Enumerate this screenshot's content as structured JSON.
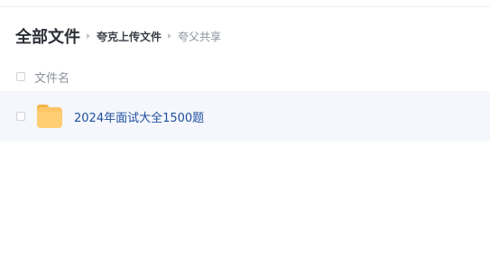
{
  "breadcrumb": {
    "root": "全部文件",
    "middle": "夸克上传文件",
    "current": "夸父共享"
  },
  "list": {
    "column_header": "文件名",
    "rows": [
      {
        "name": "2024年面试大全1500题",
        "icon": "folder-icon"
      }
    ]
  },
  "colors": {
    "row_highlight": "#f5f7fc",
    "link_text": "#1d4f9e",
    "folder": "#fcc567"
  }
}
